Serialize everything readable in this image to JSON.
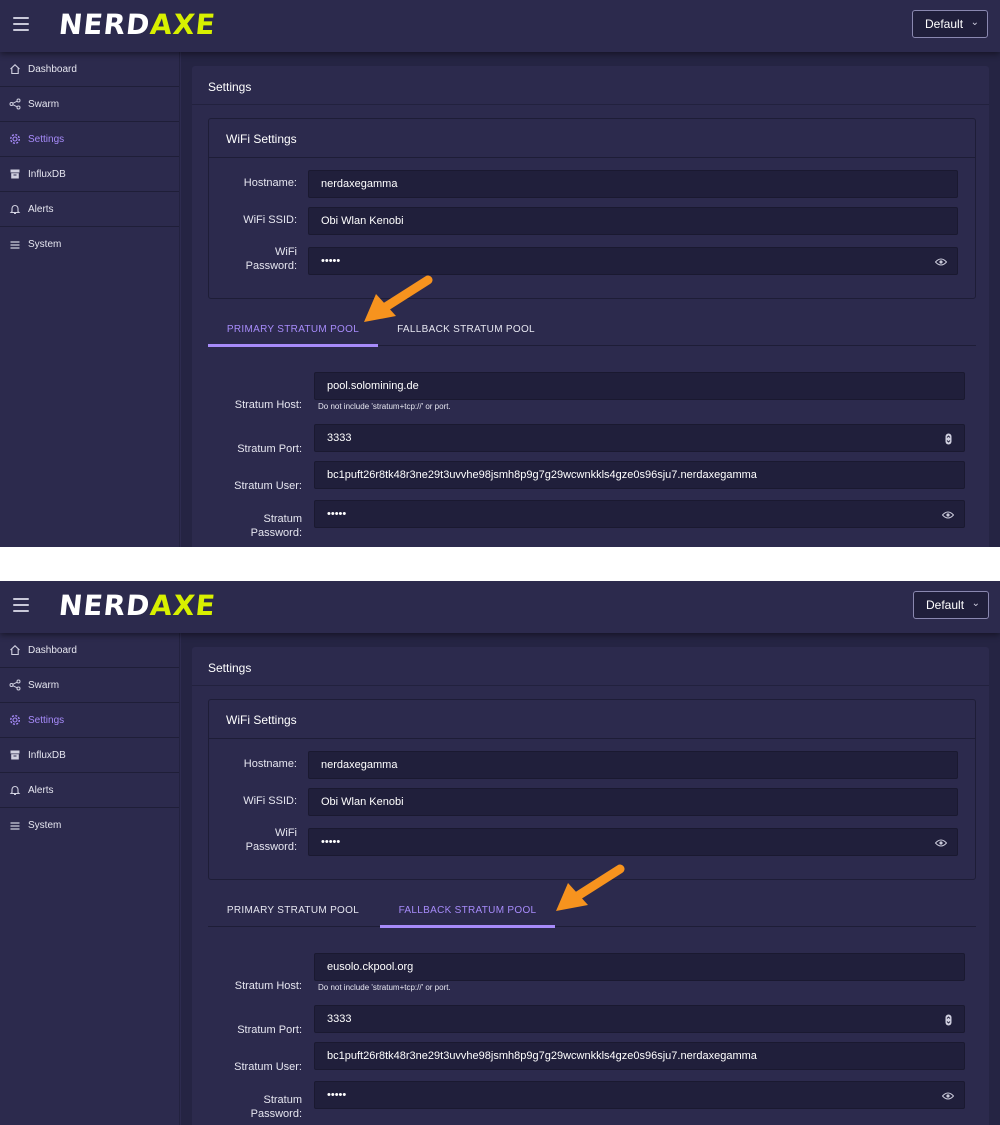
{
  "app": {
    "logo_part1": "NERD",
    "logo_part2": "AXE",
    "profile_select": "Default"
  },
  "sidebar": {
    "items": [
      {
        "label": "Dashboard",
        "icon": "home-icon"
      },
      {
        "label": "Swarm",
        "icon": "share-icon"
      },
      {
        "label": "Settings",
        "icon": "gear-icon",
        "active": true
      },
      {
        "label": "InfluxDB",
        "icon": "database-icon"
      },
      {
        "label": "Alerts",
        "icon": "bell-icon"
      },
      {
        "label": "System",
        "icon": "list-icon"
      }
    ]
  },
  "settings": {
    "title": "Settings",
    "wifi": {
      "title": "WiFi Settings",
      "hostname_label": "Hostname:",
      "hostname_value": "nerdaxegamma",
      "ssid_label": "WiFi SSID:",
      "ssid_value": "Obi Wlan Kenobi",
      "password_label_1": "WiFi",
      "password_label_2": "Password:",
      "password_value": "•••••"
    },
    "tabs": {
      "primary": "PRIMARY STRATUM POOL",
      "fallback": "FALLBACK STRATUM POOL"
    },
    "labels": {
      "host": "Stratum Host:",
      "host_hint": "Do not include 'stratum+tcp://' or port.",
      "port": "Stratum Port:",
      "user": "Stratum User:",
      "password_1": "Stratum",
      "password_2": "Password:"
    }
  },
  "screens": [
    {
      "active_tab": "primary",
      "host": "pool.solomining.de",
      "port": "3333",
      "user": "bc1puft26r8tk48r3ne29t3uvvhe98jsmh8p9g7g29wcwnkkls4gze0s96sju7.nerdaxegamma",
      "password": "•••••"
    },
    {
      "active_tab": "fallback",
      "host": "eusolo.ckpool.org",
      "port": "3333",
      "user": "bc1puft26r8tk48r3ne29t3uvvhe98jsmh8p9g7g29wcwnkkls4gze0s96sju7.nerdaxegamma",
      "password": "•••••"
    }
  ],
  "colors": {
    "background": "#2d2b4f",
    "accent": "#a78bfa",
    "logo_accent": "#d8f000",
    "annotation_arrow": "#f7931e"
  }
}
